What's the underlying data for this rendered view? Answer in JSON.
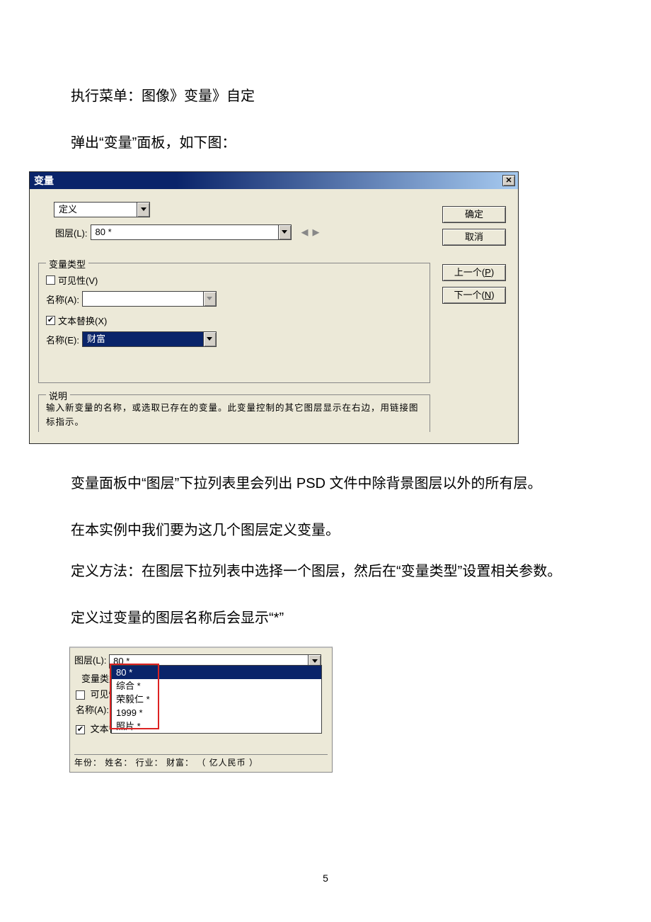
{
  "paragraphs": {
    "p1": "执行菜单：图像》变量》自定",
    "p2": "弹出“变量”面板，如下图：",
    "p3": "变量面板中“图层”下拉列表里会列出 PSD 文件中除背景图层以外的所有层。",
    "p4": "在本实例中我们要为这几个图层定义变量。",
    "p5": "定义方法：在图层下拉列表中选择一个图层，然后在“变量类型”设置相关参数。",
    "p6": "定义过变量的图层名称后会显示“*”"
  },
  "dialog": {
    "title": "变量",
    "tabSelect": "定义",
    "layerLabel": "图层(L):",
    "layerValue": "80 *",
    "group_varType": "变量类型",
    "chk_visibility": "可见性(V)",
    "nameA_label": "名称(A):",
    "nameA_value": "",
    "chk_textReplace": "文本替换(X)",
    "nameE_label": "名称(E):",
    "nameE_value": "财富",
    "group_desc": "说明",
    "desc_text": "输入新变量的名称，或选取已存在的变量。此变量控制的其它图层显示在右边，用链接图标指示。",
    "btn_ok": "确定",
    "btn_cancel": "取消",
    "btn_prev": "上一个(P)",
    "btn_next": "下一个(N)"
  },
  "snippet": {
    "layerLabel": "图层(L):",
    "layerValue": "80 *",
    "varTypeLabel": "变量类型",
    "visibility": "可见性",
    "nameA_label": "名称(A):",
    "textReplaceLine": "文本替",
    "options": [
      "80 *",
      "综合 *",
      "荣毅仁 *",
      "1999 *",
      "照片 *"
    ],
    "footer_line": "年份：  姓名：  行业：  财富：        （ 亿人民币 ）"
  },
  "page_number": "5"
}
